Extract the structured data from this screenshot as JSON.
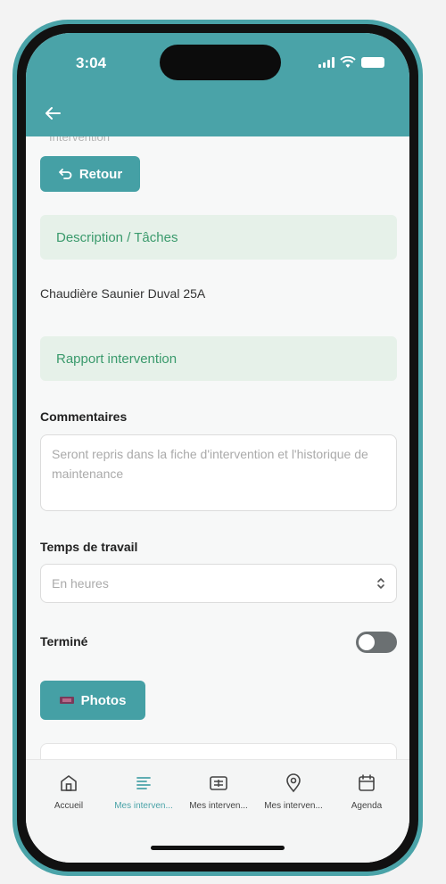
{
  "status_bar": {
    "time": "3:04"
  },
  "header": {
    "faded_label": "Intervention"
  },
  "retour_button": {
    "label": "Retour"
  },
  "sections": {
    "description_title": "Description / Tâches",
    "description_text": "Chaudière Saunier Duval 25A",
    "rapport_title": "Rapport intervention"
  },
  "form": {
    "comments_label": "Commentaires",
    "comments_placeholder": "Seront repris dans la fiche d'intervention et l'historique de maintenance",
    "work_time_label": "Temps de travail",
    "work_time_placeholder": "En heures",
    "done_label": "Terminé",
    "done_value": false
  },
  "photos_button": {
    "label": "Photos"
  },
  "tabs": [
    {
      "label": "Accueil",
      "icon": "home-icon",
      "active": false
    },
    {
      "label": "Mes interven...",
      "icon": "list-icon",
      "active": true
    },
    {
      "label": "Mes interven...",
      "icon": "calculator-icon",
      "active": false
    },
    {
      "label": "Mes interven...",
      "icon": "location-pin-icon",
      "active": false
    },
    {
      "label": "Agenda",
      "icon": "calendar-icon",
      "active": false
    }
  ],
  "colors": {
    "primary": "#4aa3a8",
    "section_bg": "#e6f1e9",
    "section_text": "#3a9a6c",
    "toggle_off": "#6b7072"
  }
}
